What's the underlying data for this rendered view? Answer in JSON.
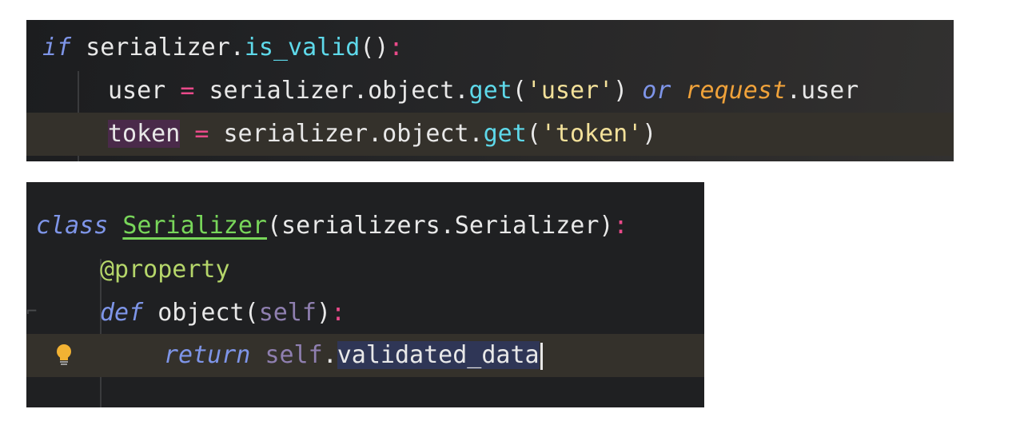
{
  "top_snippet": {
    "line1": {
      "kw": "if",
      "obj": "serializer.",
      "fn": "is_valid",
      "paren": "()",
      "colon": ":"
    },
    "line2": {
      "var": "user",
      "eq": "=",
      "obj": "serializer.object.",
      "fn": "get",
      "open": "(",
      "str": "'user'",
      "close": ")",
      "or": "or",
      "req": "request",
      "attr": ".user"
    },
    "line3": {
      "var": "token",
      "eq": "=",
      "obj": "serializer.object.",
      "fn": "get",
      "open": "(",
      "str": "'token'",
      "close": ")"
    }
  },
  "bottom_snippet": {
    "line1": {
      "kw": "class",
      "name": "Serializer",
      "base": "(serializers.Serializer)",
      "colon": ":"
    },
    "line2": {
      "decorator": "@property"
    },
    "line3": {
      "kw": "def",
      "name": "object",
      "open": "(",
      "self": "self",
      "close": ")",
      "colon": ":"
    },
    "line4": {
      "kw": "return",
      "self": "self",
      "dot": ".",
      "attr": "validated_data"
    },
    "gutter_icon": "lightbulb-icon"
  },
  "colors": {
    "keyword": "#7e95e8",
    "function": "#5ed9ea",
    "operator": "#ea4a8a",
    "string": "#f3e19a",
    "parameter": "#f0a23a",
    "class_name": "#78d65a",
    "current_line": "#34312b"
  }
}
